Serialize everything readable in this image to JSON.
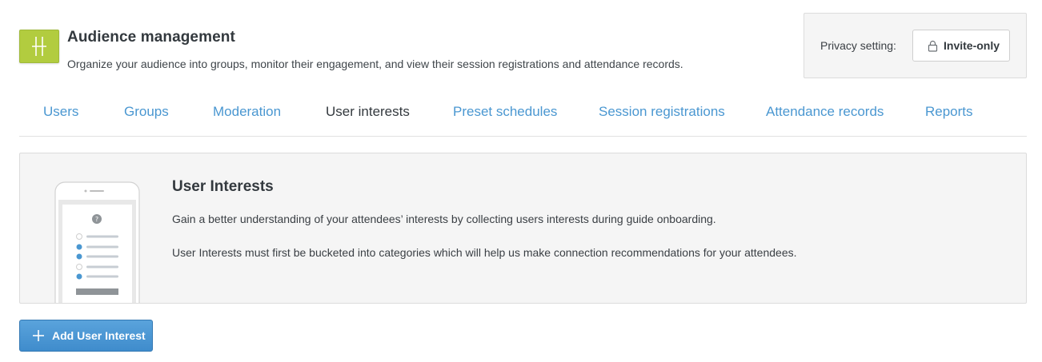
{
  "header": {
    "title": "Audience management",
    "subtitle": "Organize your audience into groups, monitor their engagement, and view their session registrations and attendance records.",
    "logo_icon": "h-letter-logo-icon",
    "logo_color": "#b2cc3f"
  },
  "privacy": {
    "label": "Privacy setting:",
    "button_label": "Invite-only",
    "icon": "lock-icon"
  },
  "tabs": [
    {
      "label": "Users",
      "active": false
    },
    {
      "label": "Groups",
      "active": false
    },
    {
      "label": "Moderation",
      "active": false
    },
    {
      "label": "User interests",
      "active": true
    },
    {
      "label": "Preset schedules",
      "active": false
    },
    {
      "label": "Session registrations",
      "active": false
    },
    {
      "label": "Attendance records",
      "active": false
    },
    {
      "label": "Reports",
      "active": false
    }
  ],
  "panel": {
    "title": "User Interests",
    "paragraph1": "Gain a better understanding of your attendees’ interests by collecting users interests during guide onboarding.",
    "paragraph2": "User Interests must first be bucketed into categories which will help us make connection recommendations for your attendees.",
    "illustration_icon": "phone-survey-illustration-icon"
  },
  "actions": {
    "add_label": "Add User Interest",
    "add_icon": "plus-icon"
  },
  "colors": {
    "link": "#4a97d1",
    "primary_button": "#4a97d1",
    "panel_bg": "#f5f5f5"
  }
}
